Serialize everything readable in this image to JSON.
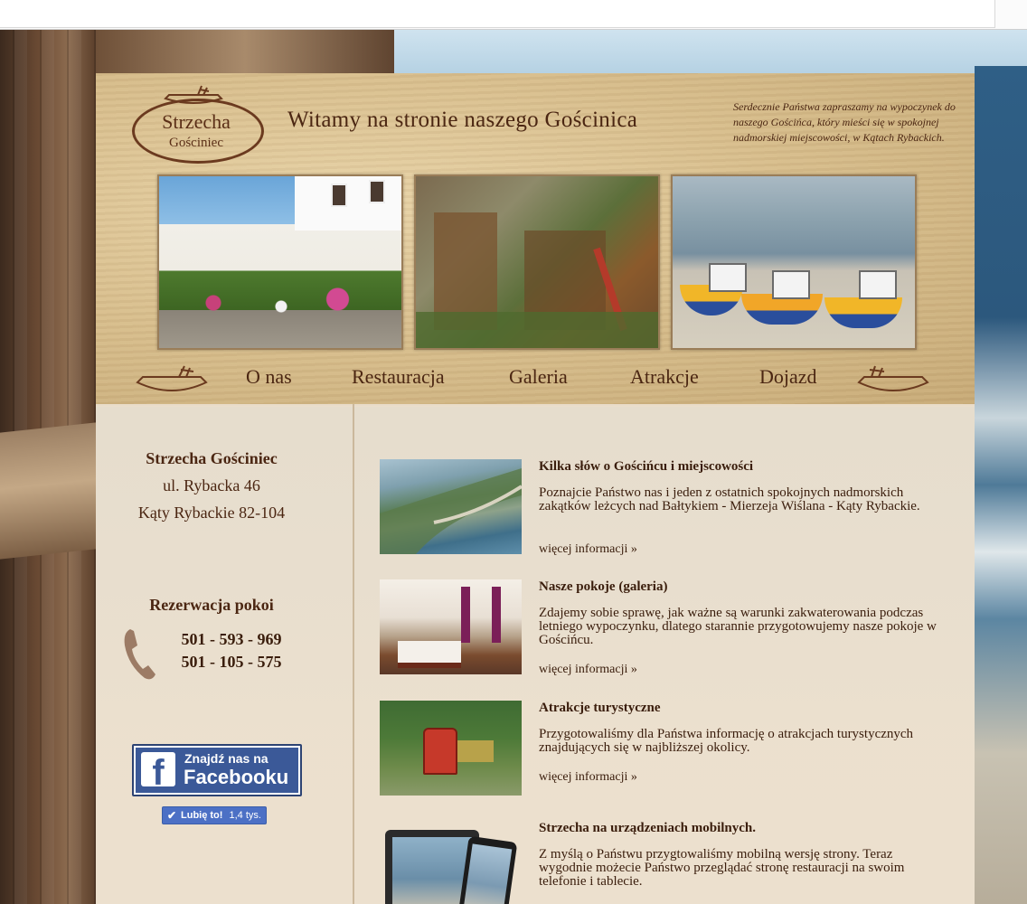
{
  "header": {
    "logo": {
      "name": "Strzecha",
      "sub": "Gościniec"
    },
    "title": "Witamy na stronie naszego Gościnica",
    "intro": "Serdecznie Państwa zapraszamy na wypoczynek do naszego Gościńca, który mieści się w spokojnej nadmorskiej miejscowości, w Kątach Rybackich."
  },
  "nav": [
    {
      "label": "O nas"
    },
    {
      "label": "Restauracja"
    },
    {
      "label": "Galeria"
    },
    {
      "label": "Atrakcje"
    },
    {
      "label": "Dojazd"
    }
  ],
  "sidebar": {
    "name": "Strzecha Gościniec",
    "street": "ul. Rybacka 46",
    "city": "Kąty Rybackie 82-104",
    "reservation_title": "Rezerwacja pokoi",
    "phone1": "501 - 593 - 969",
    "phone2": "501 - 105 - 575",
    "facebook": {
      "line1": "Znajdź nas na",
      "line2": "Facebooku",
      "logo": "f"
    },
    "like": {
      "label": "Lubię to!",
      "count": "1,4 tys."
    }
  },
  "articles": [
    {
      "title": "Kilka słów o Gościńcu i miejscowości",
      "desc": "Poznajcie Państwo nas i jeden z ostatnich spokojnych nadmorskich zakątków leżcych nad Bałtykiem - Mierzeja Wiślana - Kąty Rybackie.",
      "more": "więcej informacji »"
    },
    {
      "title": "Nasze pokoje (galeria)",
      "desc": "Zdajemy sobie sprawę, jak ważne są warunki zakwaterowania podczas letniego wypoczynku, dlatego starannie przygotowujemy nasze pokoje w Gościńcu.",
      "more": "więcej informacji »"
    },
    {
      "title": "Atrakcje turystyczne",
      "desc": "Przygotowaliśmy dla Państwa informację o atrakcjach turystycznych znajdujących się w najbliższej okolicy.",
      "more": "więcej informacji »"
    },
    {
      "title": "Strzecha na urządzeniach mobilnych.",
      "desc": "Z myślą o Państwu przygtowaliśmy mobilną wersję strony. Teraz wygodnie możecie Państwo przeglądać stronę restauracji na swoim telefonie i tablecie."
    }
  ],
  "colors": {
    "text": "#4b2612",
    "facebook": "#3b5998"
  }
}
